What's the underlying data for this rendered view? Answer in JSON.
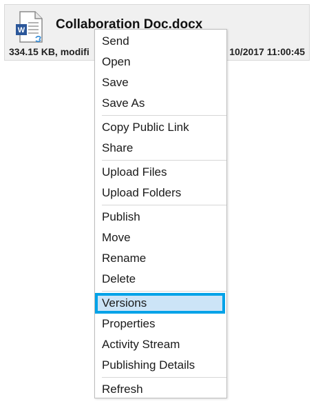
{
  "file": {
    "name": "Collaboration Doc.docx",
    "meta_left": "334.15 KB, modifi",
    "meta_right": "10/2017 11:00:45",
    "icon": "word-doc-shared-icon"
  },
  "context_menu": {
    "groups": [
      [
        {
          "label": "Send"
        },
        {
          "label": "Open"
        },
        {
          "label": "Save"
        },
        {
          "label": "Save As"
        }
      ],
      [
        {
          "label": "Copy Public Link"
        },
        {
          "label": "Share"
        }
      ],
      [
        {
          "label": "Upload Files"
        },
        {
          "label": "Upload Folders"
        }
      ],
      [
        {
          "label": "Publish"
        },
        {
          "label": "Move"
        },
        {
          "label": "Rename"
        },
        {
          "label": "Delete"
        }
      ],
      [
        {
          "label": "Versions",
          "highlighted": true
        },
        {
          "label": "Properties"
        },
        {
          "label": "Activity Stream"
        },
        {
          "label": "Publishing Details"
        }
      ],
      [
        {
          "label": "Refresh"
        }
      ]
    ]
  },
  "colors": {
    "highlight_fill": "#cce4f7",
    "highlight_border": "#00a2e8",
    "word_blue": "#2b579a"
  }
}
